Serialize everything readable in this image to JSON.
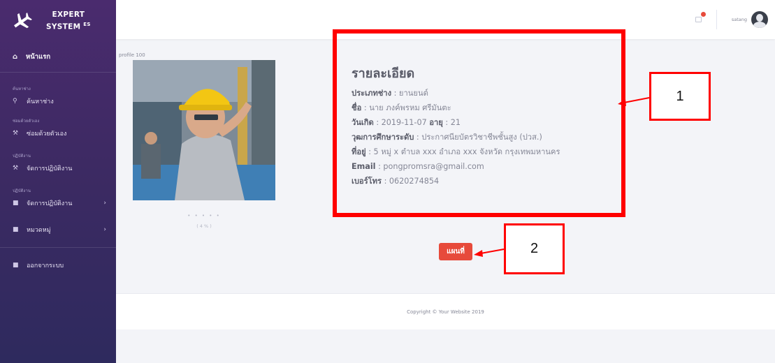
{
  "sidebar": {
    "brand": {
      "line1": "EXPERT",
      "line2": "SYSTEM",
      "sup": "ES"
    },
    "home": {
      "label": "หน้าแรก",
      "icon": "home-icon"
    },
    "sections": [
      {
        "label": "ค้นหาช่าง",
        "item": {
          "label": "ค้นหาช่าง",
          "icon": "search-icon"
        }
      },
      {
        "label": "ซ่อมด้วยตัวเอง",
        "item": {
          "label": "ซ่อมด้วยตัวเอง",
          "icon": "wrench-icon"
        }
      },
      {
        "label": "ปฏิบัติงาน",
        "item": {
          "label": "จัดการปฏิบัติงาน",
          "icon": "wrench-icon"
        }
      },
      {
        "label": "ปฏิบัติงาน",
        "item": {
          "label": "จัดการปฏิบัติงาน",
          "icon": "folder-icon"
        }
      }
    ],
    "category": {
      "label": "หมวดหมู่",
      "icon": "folder-icon"
    },
    "logout": {
      "label": "ออกจากระบบ",
      "icon": "folder-icon"
    }
  },
  "topbar": {
    "username": "satang",
    "notification_icon": "notification-icon",
    "avatar_icon": "user-avatar-icon"
  },
  "profile": {
    "caption": "profile 100",
    "rating_stars": "• • • • •",
    "rating_percent": "( 4 % )"
  },
  "details": {
    "heading": "รายละเอียด",
    "rows": [
      {
        "label": "ประเภทช่าง",
        "value": " : ยานยนต์"
      },
      {
        "label": "ชื่อ",
        "value": " : นาย ภงค์พรหม ศรีมันตะ"
      },
      {
        "label": "วันเกิด",
        "value": " : 2019-11-07 ",
        "label2": "อายุ",
        "value2": " : 21"
      },
      {
        "label": "วุฒการศึกษาระดับ",
        "value": " : ประกาศนียบัตรวิชาชีพชั้นสูง (ปวส.)"
      },
      {
        "label": "ที่อยู่",
        "value": " : 5 หมู่ x ตำบล xxx อำเภอ xxx จังหวัด กรุงเทพมหานคร"
      },
      {
        "label": "Email",
        "value": " : pongpromsra@gmail.com"
      },
      {
        "label": "เบอร์โทร",
        "value": " : 0620274854"
      }
    ]
  },
  "map_button": {
    "label": "แผนที่"
  },
  "callouts": {
    "one": "1",
    "two": "2"
  },
  "colors": {
    "annotation_red": "#ff0000",
    "button_red": "#e74a3b",
    "sidebar_top": "#4a2b6e",
    "sidebar_bottom": "#2e2a5e"
  },
  "footer": {
    "text": "Copyright © Your Website 2019"
  }
}
